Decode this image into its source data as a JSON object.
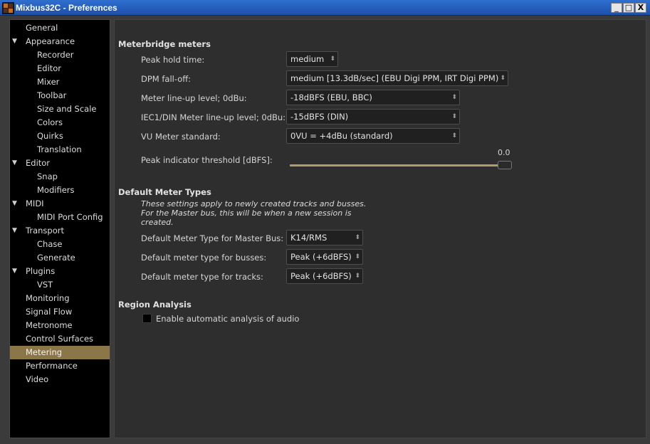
{
  "window": {
    "title": "Mixbus32C - Preferences",
    "min": "_",
    "max": "□",
    "close": "X"
  },
  "sidebar": {
    "items": [
      {
        "label": "General"
      },
      {
        "label": "Appearance",
        "expander": "▼"
      },
      {
        "label": "Recorder"
      },
      {
        "label": "Editor"
      },
      {
        "label": "Mixer"
      },
      {
        "label": "Toolbar"
      },
      {
        "label": "Size and Scale"
      },
      {
        "label": "Colors"
      },
      {
        "label": "Quirks"
      },
      {
        "label": "Translation"
      },
      {
        "label": "Editor",
        "expander": "▼"
      },
      {
        "label": "Snap"
      },
      {
        "label": "Modifiers"
      },
      {
        "label": "MIDI",
        "expander": "▼"
      },
      {
        "label": "MIDI Port Config"
      },
      {
        "label": "Transport",
        "expander": "▼"
      },
      {
        "label": "Chase"
      },
      {
        "label": "Generate"
      },
      {
        "label": "Plugins",
        "expander": "▼"
      },
      {
        "label": "VST"
      },
      {
        "label": "Monitoring"
      },
      {
        "label": "Signal Flow"
      },
      {
        "label": "Metronome"
      },
      {
        "label": "Control Surfaces"
      },
      {
        "label": "Metering",
        "selected": true
      },
      {
        "label": "Performance"
      },
      {
        "label": "Video"
      }
    ]
  },
  "meterbridge": {
    "heading": "Meterbridge meters",
    "peak_hold_label": "Peak hold time:",
    "peak_hold_value": "medium",
    "dpm_label": "DPM fall-off:",
    "dpm_value": "medium [13.3dB/sec] (EBU Digi PPM, IRT Digi PPM)",
    "lineup_label": "Meter line-up level; 0dBu:",
    "lineup_value": "-18dBFS (EBU, BBC)",
    "iec_label": "IEC1/DIN Meter line-up level; 0dBu:",
    "iec_value": "-15dBFS (DIN)",
    "vu_label": "VU Meter standard:",
    "vu_value": "0VU = +4dBu (standard)",
    "peak_threshold_label": "Peak indicator threshold [dBFS]:",
    "peak_threshold_value": "0.0"
  },
  "default_types": {
    "heading": "Default Meter Types",
    "note_1": "These settings apply to newly created tracks and busses.",
    "note_2": "For the Master bus, this will be when a new session is",
    "note_3": "created.",
    "master_label": "Default Meter Type for Master Bus:",
    "master_value": "K14/RMS",
    "busses_label": "Default meter type for busses:",
    "busses_value": "Peak (+6dBFS)",
    "tracks_label": "Default meter type for tracks:",
    "tracks_value": "Peak (+6dBFS)"
  },
  "region": {
    "heading": "Region Analysis",
    "auto_analysis_label": "Enable automatic analysis of audio",
    "auto_analysis_checked": false
  },
  "icons": {
    "combo_arrow": "⬍",
    "expander": "▼"
  },
  "colors": {
    "selection": "#8b7647",
    "titlebar": "#2f6fd0",
    "slider": "#b19c66"
  }
}
